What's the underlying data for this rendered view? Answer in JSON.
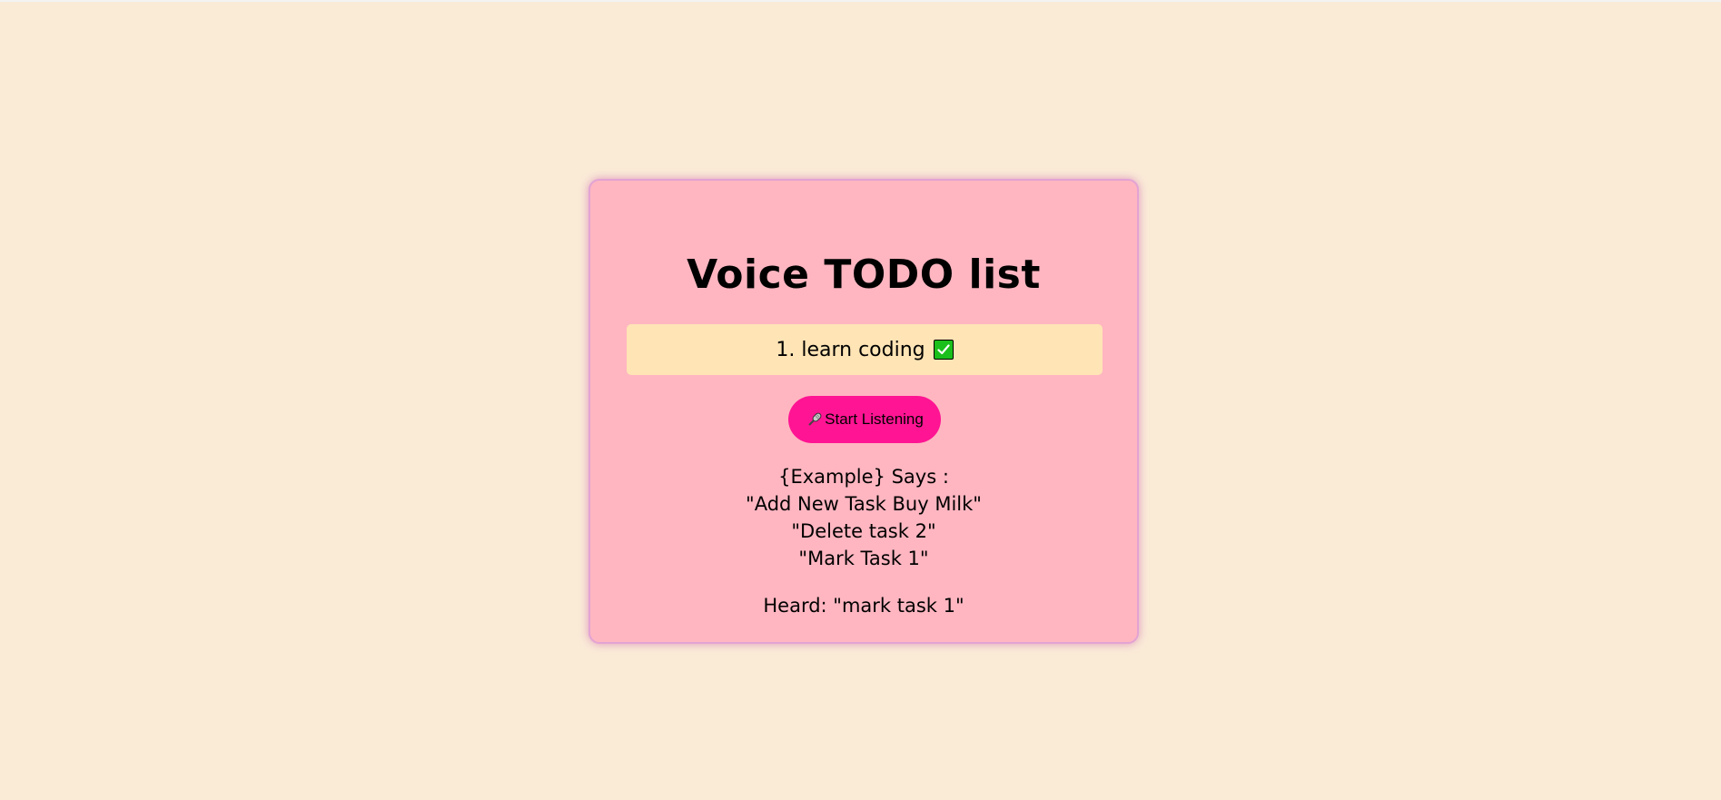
{
  "app": {
    "title": "Voice TODO list"
  },
  "tasks": [
    {
      "text": "1. learn coding",
      "done_icon": "check-mark-icon"
    }
  ],
  "listen_button": {
    "icon": "microphone-icon",
    "label": "Start Listening"
  },
  "examples": {
    "header": "{Example} Says :",
    "lines": [
      "\"Add New Task Buy Milk\"",
      "\"Delete task 2\"",
      "\"Mark Task 1\""
    ]
  },
  "heard": {
    "text": "Heard: \"mark task 1\""
  },
  "colors": {
    "page_background": "#faebd7",
    "card_background": "#ffb6c1",
    "task_background": "#ffe4b5",
    "button_background": "#ff1493",
    "check_green": "#1bbf1b"
  }
}
